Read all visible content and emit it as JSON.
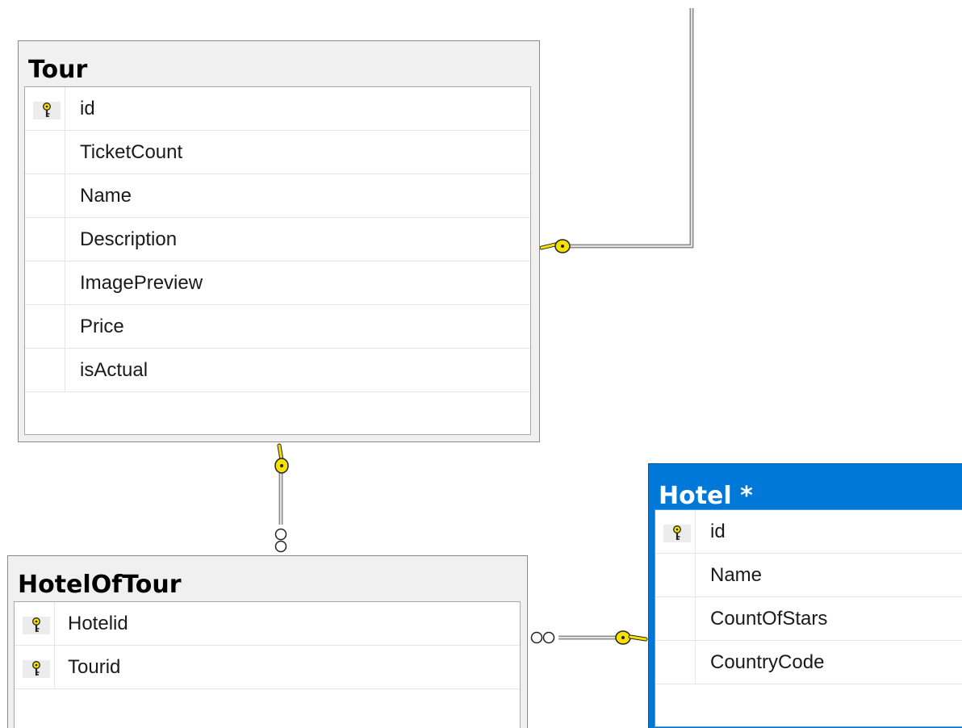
{
  "tables": {
    "tour": {
      "title": "Tour",
      "columns": [
        {
          "name": "id",
          "key": true
        },
        {
          "name": "TicketCount",
          "key": false
        },
        {
          "name": "Name",
          "key": false
        },
        {
          "name": "Description",
          "key": false
        },
        {
          "name": "ImagePreview",
          "key": false
        },
        {
          "name": "Price",
          "key": false
        },
        {
          "name": "isActual",
          "key": false
        }
      ]
    },
    "hotel_of_tour": {
      "title": "HotelOfTour",
      "columns": [
        {
          "name": "Hotelid",
          "key": true
        },
        {
          "name": "Tourid",
          "key": true
        }
      ]
    },
    "hotel": {
      "title": "Hotel *",
      "selected": true,
      "columns": [
        {
          "name": "id",
          "key": true
        },
        {
          "name": "Name",
          "key": false
        },
        {
          "name": "CountOfStars",
          "key": false
        },
        {
          "name": "CountryCode",
          "key": false
        }
      ]
    }
  },
  "relationships": [
    {
      "from": "HotelOfTour",
      "to": "Tour",
      "one_end": "Tour",
      "many_end": "HotelOfTour"
    },
    {
      "from": "HotelOfTour",
      "to": "Hotel",
      "one_end": "Hotel",
      "many_end": "HotelOfTour"
    },
    {
      "from": "external",
      "to": "Tour",
      "one_end": "Tour",
      "many_end": "external"
    }
  ],
  "colors": {
    "canvas": "#ffffff",
    "table_frame": "#f0f0f0",
    "selected_frame": "#0078d7",
    "key_icon": "#f5e000",
    "connector": "#8c8c8c"
  }
}
